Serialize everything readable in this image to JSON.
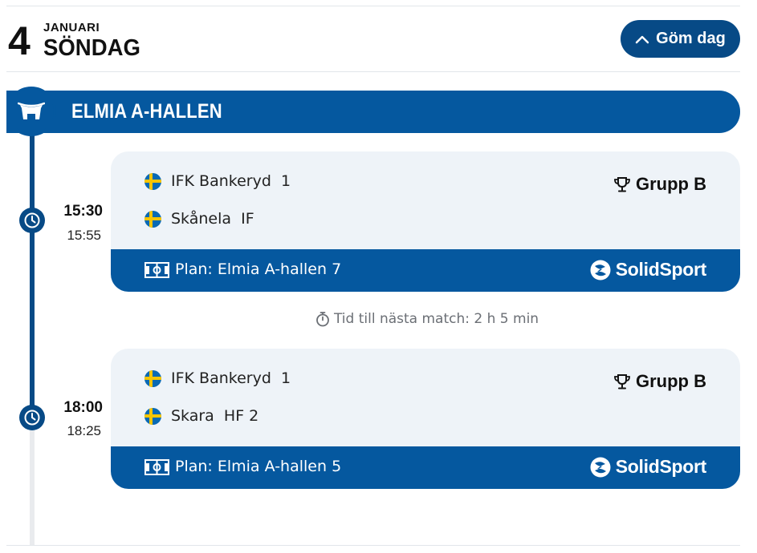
{
  "day": {
    "number": "4",
    "month": "JANUARI",
    "weekday": "SÖNDAG",
    "hide_button_label": "Göm dag"
  },
  "venue": {
    "name": "ELMIA A-HALLEN",
    "icon": "arena-icon"
  },
  "matches": [
    {
      "start_time": "15:30",
      "end_time": "15:55",
      "home_team": "IFK Bankeryd  1",
      "away_team": "Skånela  IF",
      "group": "Grupp B",
      "field": "Plan: Elmia A-hallen 7",
      "stream_brand": "SolidSport"
    },
    {
      "start_time": "18:00",
      "end_time": "18:25",
      "home_team": "IFK Bankeryd  1",
      "away_team": "Skara  HF 2",
      "group": "Grupp B",
      "field": "Plan: Elmia A-hallen 5",
      "stream_brand": "SolidSport"
    }
  ],
  "next_match_text": "Tid till nästa match: 2 h 5 min",
  "colors": {
    "primary": "#05589f",
    "primary_dark": "#074a86",
    "card_bg": "#eef3f8",
    "flag_blue": "#0a6ab4",
    "flag_yellow": "#f6c500"
  }
}
